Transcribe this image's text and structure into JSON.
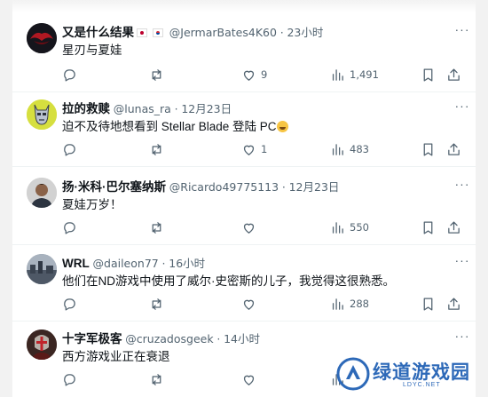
{
  "tweets": [
    {
      "name": "又是什么结果",
      "flags": [
        "jp",
        "kr"
      ],
      "handle": "@JermarBates4K60",
      "time": "23小时",
      "text": "星刃与夏娃",
      "replies": "",
      "retweets": "",
      "likes": "9",
      "views": "1,491"
    },
    {
      "name": "拉的救赎",
      "handle": "@lunas_ra",
      "time": "12月23日",
      "text": "迫不及待地想看到 Stellar Blade 登陆 PC",
      "replies": "",
      "retweets": "",
      "likes": "1",
      "views": "483"
    },
    {
      "name": "扬·米科·巴尔塞纳斯",
      "handle": "@Ricardo49775113",
      "time": "12月23日",
      "text": "夏娃万岁！",
      "replies": "",
      "retweets": "",
      "likes": "",
      "views": "550"
    },
    {
      "name": "WRL",
      "handle": "@daileon77",
      "time": "16小时",
      "text": "他们在ND游戏中使用了威尔·史密斯的儿子，我觉得这很熟悉。",
      "replies": "",
      "retweets": "",
      "likes": "",
      "views": "288"
    },
    {
      "name": "十字军极客",
      "handle": "@cruzadosgeek",
      "time": "14小时",
      "text": "西方游戏业正在衰退",
      "replies": "",
      "retweets": "",
      "likes": "",
      "views": ""
    }
  ],
  "separator": "·",
  "more_glyph": "···",
  "watermark": {
    "title": "绿道游戏园",
    "subtitle": "LDYC.NET"
  },
  "colors": {
    "text": "#0f1419",
    "muted": "#536471",
    "divider": "#eff3f4",
    "watermark": "#2d69b8"
  }
}
